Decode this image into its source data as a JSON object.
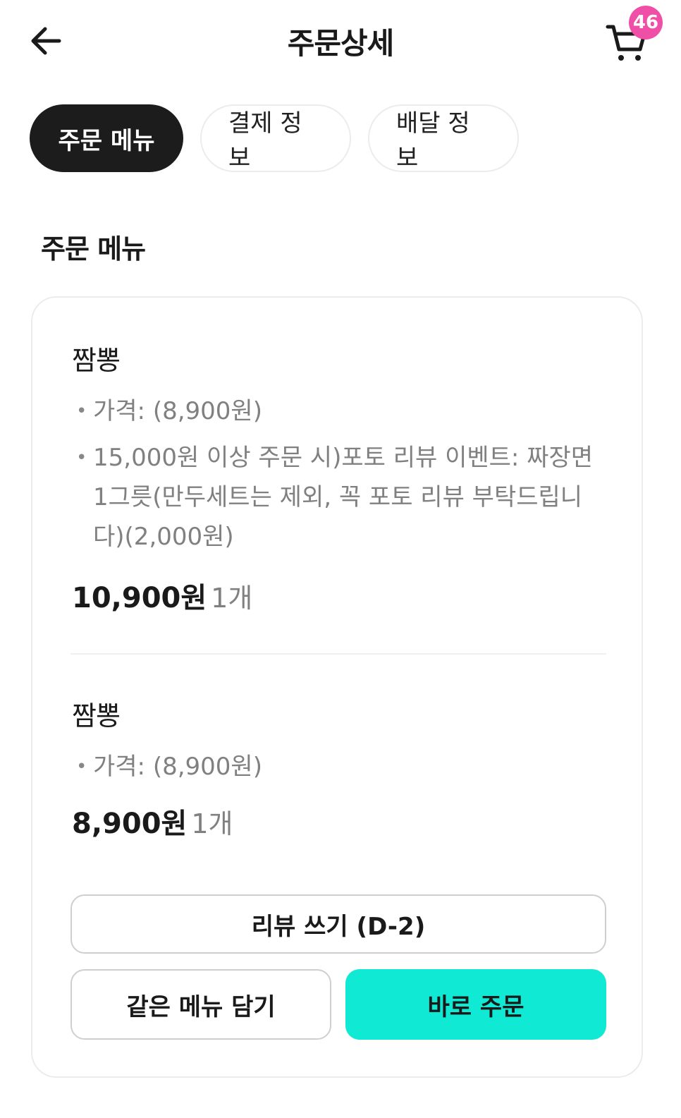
{
  "header": {
    "title": "주문상세",
    "back_icon": "arrow-left-icon",
    "cart_icon": "shopping-cart-icon",
    "cart_count": "46",
    "badge_color": "#ef4fa6"
  },
  "tabs": [
    {
      "label": "주문 메뉴",
      "active": true
    },
    {
      "label": "결제 정보",
      "active": false
    },
    {
      "label": "배달 정보",
      "active": false
    }
  ],
  "section": {
    "title": "주문 메뉴"
  },
  "items": [
    {
      "name": "짬뽕",
      "options": [
        "가격:  (8,900원)",
        "15,000원 이상 주문 시)포토 리뷰 이벤트: 짜장면1그릇(만두세트는 제외, 꼭 포토 리뷰 부탁드립니다)(2,000원)"
      ],
      "price": "10,900원",
      "quantity": "1개"
    },
    {
      "name": "짬뽕",
      "options": [
        "가격:  (8,900원)"
      ],
      "price": "8,900원",
      "quantity": "1개"
    }
  ],
  "actions": {
    "review_label": "리뷰 쓰기 (D-2)",
    "readd_label": "같은 메뉴 담기",
    "order_label": "바로 주문",
    "order_color": "#10e9d4"
  }
}
